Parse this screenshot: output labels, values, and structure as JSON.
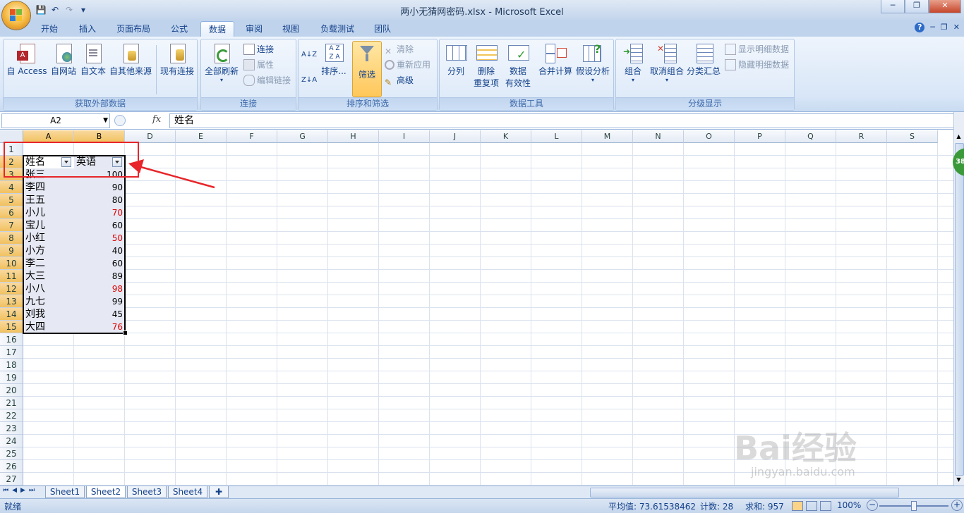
{
  "window": {
    "title": "两小无猜网密码.xlsx - Microsoft Excel",
    "min": "─",
    "max": "❐",
    "close": "✕"
  },
  "qat": {
    "save": "💾",
    "undo": "↶",
    "redo": "↷",
    "more": "▾"
  },
  "tabs": [
    "开始",
    "插入",
    "页面布局",
    "公式",
    "数据",
    "审阅",
    "视图",
    "负载测试",
    "团队"
  ],
  "tab_right": {
    "help": "?",
    "min": "─",
    "restore": "❐",
    "close": "✕"
  },
  "ribbon": {
    "groups": {
      "external": "获取外部数据",
      "connections": "连接",
      "sort_filter": "排序和筛选",
      "data_tools": "数据工具",
      "outline": "分级显示"
    },
    "buttons": {
      "access": "自 Access",
      "web": "自网站",
      "text": "自文本",
      "other": "自其他来源",
      "existing": "现有连接",
      "refresh_all": "全部刷新",
      "connect": "连接",
      "properties": "属性",
      "edit_links": "编辑链接",
      "sort_az": "A↓Z",
      "sort_za": "Z↓A",
      "sort": "排序...",
      "filter": "筛选",
      "clear": "清除",
      "reapply": "重新应用",
      "advanced": "高级",
      "text_to_cols": "分列",
      "remove_dup_1": "删除",
      "remove_dup_2": "重复项",
      "validation_1": "数据",
      "validation_2": "有效性",
      "consolidate": "合并计算",
      "whatif": "假设分析",
      "group": "组合",
      "ungroup": "取消组合",
      "subtotal": "分类汇总",
      "show_detail": "显示明细数据",
      "hide_detail": "隐藏明细数据"
    }
  },
  "formula_bar": {
    "name_box": "A2",
    "fx": "fx",
    "content": "姓名"
  },
  "columns": [
    "A",
    "B",
    "D",
    "E",
    "F",
    "G",
    "H",
    "I",
    "J",
    "K",
    "L",
    "M",
    "N",
    "O",
    "P",
    "Q",
    "R",
    "S"
  ],
  "rows": [
    "1",
    "2",
    "3",
    "4",
    "5",
    "6",
    "7",
    "8",
    "9",
    "10",
    "11",
    "12",
    "13",
    "14",
    "15",
    "16",
    "17",
    "18",
    "19",
    "20",
    "21",
    "22",
    "23",
    "24",
    "25",
    "26",
    "27"
  ],
  "table": {
    "headers": [
      "姓名",
      "英语"
    ],
    "data": [
      {
        "name": "张三",
        "score": "100",
        "highlight": false
      },
      {
        "name": "李四",
        "score": "90",
        "highlight": false
      },
      {
        "name": "王五",
        "score": "80",
        "highlight": false
      },
      {
        "name": "小儿",
        "score": "70",
        "highlight": true
      },
      {
        "name": "宝儿",
        "score": "60",
        "highlight": false
      },
      {
        "name": "小红",
        "score": "50",
        "highlight": true
      },
      {
        "name": "小方",
        "score": "40",
        "highlight": false
      },
      {
        "name": "李二",
        "score": "60",
        "highlight": false
      },
      {
        "name": "大三",
        "score": "89",
        "highlight": false
      },
      {
        "name": "小八",
        "score": "98",
        "highlight": true
      },
      {
        "name": "九七",
        "score": "99",
        "highlight": false
      },
      {
        "name": "刘我",
        "score": "45",
        "highlight": false
      },
      {
        "name": "大四",
        "score": "76",
        "highlight": true
      }
    ]
  },
  "sheets": [
    "Sheet1",
    "Sheet2",
    "Sheet3",
    "Sheet4"
  ],
  "sheet_nav": [
    "⏮",
    "◀",
    "▶",
    "⏭"
  ],
  "status": {
    "ready": "就绪",
    "average": "平均值: 73.61538462",
    "count": "计数: 28",
    "sum": "求和: 957",
    "zoom": "100%",
    "zoom_out": "−",
    "zoom_in": "+"
  },
  "badge": "38",
  "watermark": {
    "brand": "Bai经验",
    "url": "jingyan.baidu.com"
  },
  "colors": {
    "accent": "#15428b",
    "highlight": "#e00000",
    "annotation": "#e8252a"
  }
}
